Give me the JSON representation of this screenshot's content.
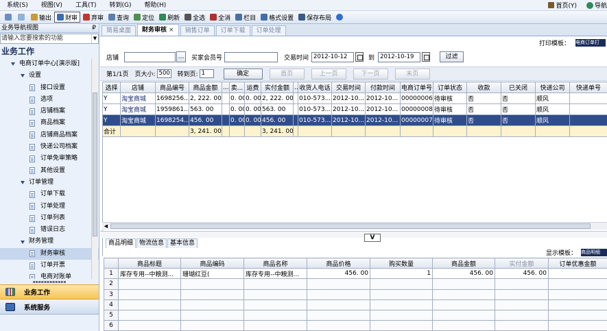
{
  "menu": {
    "items": [
      "系统(S)",
      "视图(V)",
      "工具(T)",
      "转到(G)",
      "帮助(H)"
    ],
    "home": "首页(Y)",
    "nav": "导航"
  },
  "toolbar": {
    "items": [
      {
        "label": "",
        "icon": "print-icon",
        "color": "#6b8fc4"
      },
      {
        "label": "",
        "icon": "preview-icon",
        "color": "#8fb3d9"
      },
      {
        "label": "输出",
        "icon": "export-icon",
        "color": "#c99a3a"
      },
      {
        "label": "财审",
        "icon": "audit-icon",
        "color": "#3a6db5"
      },
      {
        "label": "弃审",
        "icon": "unaudit-icon",
        "color": "#c0392b"
      },
      {
        "label": "查询",
        "icon": "query-icon",
        "color": "#5a7fb0"
      },
      {
        "label": "定位",
        "icon": "locate-icon",
        "color": "#4f8f4f"
      },
      {
        "label": "刷新",
        "icon": "refresh-icon",
        "color": "#2e8b57"
      },
      {
        "label": "全选",
        "icon": "select-all-icon",
        "color": "#555"
      },
      {
        "label": "全消",
        "icon": "deselect-all-icon",
        "color": "#b03030"
      },
      {
        "label": "栏目",
        "icon": "columns-icon",
        "color": "#4a6fa5"
      },
      {
        "label": "格式设置",
        "icon": "format-settings-icon",
        "color": "#3f6fb0"
      },
      {
        "label": "保存布局",
        "icon": "save-layout-icon",
        "color": "#3a5a8a"
      },
      {
        "label": "",
        "icon": "help-icon",
        "color": "#2f6fd0"
      }
    ]
  },
  "sidebar": {
    "title": "业务导航视图",
    "pin": "₽",
    "search_placeholder": "请输入您要搜索的功能",
    "heading": "业务工作",
    "tree": [
      {
        "label": "电商订单中心[演示版]",
        "level": 1,
        "type": "folder"
      },
      {
        "label": "设置",
        "level": 2,
        "type": "folder"
      },
      {
        "label": "接口设置",
        "level": 3,
        "type": "doc"
      },
      {
        "label": "选项",
        "level": 3,
        "type": "doc"
      },
      {
        "label": "店铺档案",
        "level": 3,
        "type": "doc"
      },
      {
        "label": "商品档案",
        "level": 3,
        "type": "doc"
      },
      {
        "label": "店铺商品档案",
        "level": 3,
        "type": "doc"
      },
      {
        "label": "快递公司档案",
        "level": 3,
        "type": "doc"
      },
      {
        "label": "订单免审策略",
        "level": 3,
        "type": "doc"
      },
      {
        "label": "其他设置",
        "level": 3,
        "type": "doc"
      },
      {
        "label": "订单管理",
        "level": 2,
        "type": "folder"
      },
      {
        "label": "订单下载",
        "level": 3,
        "type": "doc"
      },
      {
        "label": "订单处理",
        "level": 3,
        "type": "doc"
      },
      {
        "label": "订单列表",
        "level": 3,
        "type": "doc"
      },
      {
        "label": "错误日志",
        "level": 3,
        "type": "doc"
      },
      {
        "label": "财务管理",
        "level": 2,
        "type": "folder"
      },
      {
        "label": "财务审核",
        "level": 3,
        "type": "doc",
        "selected": true
      },
      {
        "label": "订单开票",
        "level": 3,
        "type": "doc"
      },
      {
        "label": "电商对账单",
        "level": 3,
        "type": "doc"
      }
    ],
    "bottom": [
      {
        "label": "业务工作",
        "active": true
      },
      {
        "label": "系统服务",
        "active": false
      }
    ]
  },
  "tabs": [
    {
      "label": "简易桌面",
      "active": false
    },
    {
      "label": "财务审核",
      "active": true,
      "close": "×"
    },
    {
      "label": "销售订单",
      "active": false
    },
    {
      "label": "订单下载",
      "active": false
    },
    {
      "label": "订单处理",
      "active": false
    }
  ],
  "print_template": {
    "label": "打印模板：",
    "value": "电商订单打"
  },
  "filter": {
    "shop_label": "店铺",
    "shop_value": "",
    "browse": "...",
    "buyer_label": "买家会员号",
    "buyer_value": "",
    "date_label": "交易时间",
    "date_from": "2012-10-12",
    "to_label": "到",
    "date_to": "2012-10-19",
    "filter_button": "过滤"
  },
  "pager": {
    "page_info": "第1/1页",
    "page_size_label": "页大小:",
    "page_size": "500",
    "goto_label": "转到页:",
    "goto_value": "1",
    "confirm": "确定",
    "first": "首页",
    "prev": "上一页",
    "next": "下一页",
    "last": "末页"
  },
  "orders": {
    "columns": [
      "选择",
      "店铺",
      "商品编号",
      "商品金额",
      "...",
      "卖...",
      "运费",
      "实付金额",
      "...",
      "收货人电话",
      "交易时间",
      "付款时间",
      "电商订单号",
      "订单状态",
      "收款",
      "已关闭",
      "快递公司",
      "快递单号"
    ],
    "rows": [
      {
        "sel": "Y",
        "shop": "淘宝商城",
        "code": "1698256...",
        "amount": "2, 222. 00",
        "c4": "",
        "seller": "0. 00",
        "freight": "0. 00",
        "paid": "2, 222. 00",
        "c8": "",
        "phone": "010-573...",
        "trade_time": "2012-10...",
        "pay_time": "2012-10...",
        "order_no": "00000006",
        "status": "待审核",
        "receipt": "否",
        "closed": "否",
        "express": "顺风",
        "express_no": ""
      },
      {
        "sel": "Y",
        "shop": "淘宝商城",
        "code": "1959861...",
        "amount": "563. 00",
        "c4": "",
        "seller": "0. 00",
        "freight": "0. 00",
        "paid": "563. 00",
        "c8": "",
        "phone": "010-573...",
        "trade_time": "2012-10...",
        "pay_time": "2012-10...",
        "order_no": "00000008",
        "status": "待审核",
        "receipt": "否",
        "closed": "否",
        "express": "顺风",
        "express_no": ""
      },
      {
        "sel": "Y",
        "shop": "淘宝商城",
        "code": "1698254...",
        "amount": "456. 00",
        "c4": "",
        "seller": "0. 00",
        "freight": "0. 00",
        "paid": "456. 00",
        "c8": "",
        "phone": "010-573...",
        "trade_time": "2012-10...",
        "pay_time": "2012-10...",
        "order_no": "00000007",
        "status": "待审核",
        "receipt": "否",
        "closed": "否",
        "express": "顺风",
        "express_no": "",
        "selected": true
      }
    ],
    "total_label": "合计",
    "total_amount": "3, 241. 00",
    "total_paid": "3, 241. 00"
  },
  "splitter_toggle": "V",
  "subtabs": [
    {
      "label": "商品明细",
      "active": true
    },
    {
      "label": "物流信息",
      "active": false
    },
    {
      "label": "基本信息",
      "active": false
    }
  ],
  "display_template": {
    "label": "显示模板：",
    "value": "商品明细"
  },
  "details": {
    "columns": [
      "",
      "商品标题",
      "商品编码",
      "商品名称",
      "商品价格",
      "购买数量",
      "商品金额",
      "实付金额",
      "订单优惠金额"
    ],
    "rows": [
      {
        "n": "1",
        "title": "库存专用--中粮测...",
        "code": "珊瑚红豆(",
        "name": "库存专用--中粮测...",
        "price": "456. 00",
        "qty": "1",
        "amount": "456. 00",
        "paid": "456. 00",
        "discount": ""
      },
      {
        "n": "2"
      },
      {
        "n": "3"
      },
      {
        "n": "4"
      },
      {
        "n": "5"
      },
      {
        "n": "6"
      }
    ]
  }
}
